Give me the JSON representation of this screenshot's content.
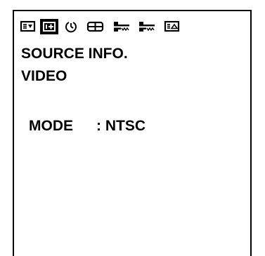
{
  "menu": {
    "tabs": [
      {
        "icon": "picture-adjust-icon"
      },
      {
        "icon": "source-info-icon",
        "active": true
      },
      {
        "icon": "timer-icon"
      },
      {
        "icon": "display-layout-icon"
      },
      {
        "icon": "setup-icon"
      },
      {
        "icon": "advanced-setup-icon"
      },
      {
        "icon": "option-icon"
      }
    ]
  },
  "screen": {
    "title": "SOURCE INFO.",
    "subtitle": "VIDEO",
    "rows": [
      {
        "label": "MODE",
        "value": ": NTSC"
      }
    ]
  },
  "colors": {
    "foreground": "#000000",
    "background": "#ffffff",
    "active_tab_bg": "#000000"
  }
}
